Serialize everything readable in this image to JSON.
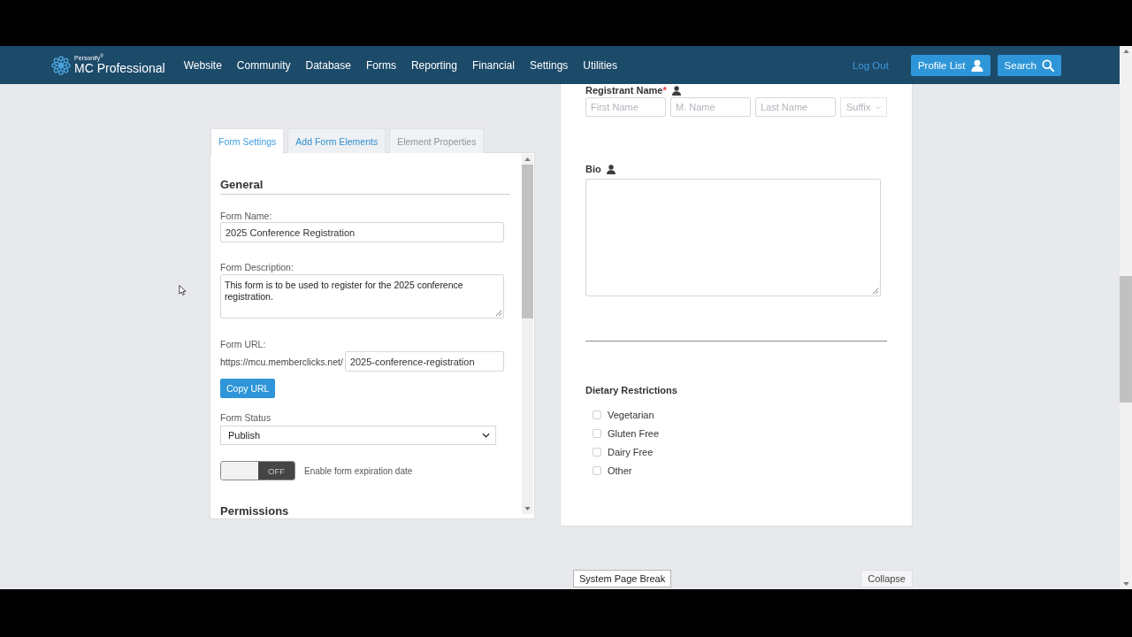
{
  "nav": {
    "logo": {
      "tagline": "Personify$^{®}$",
      "name": "MC Professional"
    },
    "menu": [
      {
        "label": "Website"
      },
      {
        "label": "Community"
      },
      {
        "label": "Database"
      },
      {
        "label": "Forms"
      },
      {
        "label": "Reporting"
      },
      {
        "label": "Financial"
      },
      {
        "label": "Settings"
      },
      {
        "label": "Utilities"
      }
    ],
    "logout": "Log Out",
    "buttons": [
      {
        "kind": "profile_list",
        "label": "Profile List"
      },
      {
        "kind": "search",
        "label": "Search"
      }
    ]
  },
  "form_builder": {
    "tabs": [
      {
        "label": "Form Settings",
        "selected": true,
        "disabled": false
      },
      {
        "label": "Add Form Elements",
        "selected": false,
        "disabled": false
      },
      {
        "label": "Element Properties",
        "selected": false,
        "disabled": true
      }
    ],
    "settings": {
      "general_heading": "General",
      "form_name": {
        "label": "Form Name:",
        "value": "2025 Conference Registration"
      },
      "form_description": {
        "label": "Form Description:",
        "value": "This form is to be used to register for the 2025 conference registration."
      },
      "form_url": {
        "label": "Form URL:",
        "prefix": "https://mcu.memberclicks.net/",
        "value": "2025-conference-registration",
        "copy_button": "Copy URL"
      },
      "form_status": {
        "label": "Form Status",
        "value": "Publish"
      },
      "expiration": {
        "on": false,
        "state_label": "OFF",
        "label": "Enable form expiration date"
      },
      "permissions_heading": "Permissions"
    }
  },
  "preview": {
    "fields": [
      {
        "kind": "name",
        "label": "Registrant Name",
        "required_mark": "*",
        "profile_linked": true,
        "parts": [
          {
            "placeholder": "First Name"
          },
          {
            "placeholder": "M. Name"
          },
          {
            "placeholder": "Last Name"
          }
        ],
        "suffix": {
          "placeholder": "Suffix"
        }
      },
      {
        "kind": "textarea",
        "label": "Bio",
        "profile_linked": true
      },
      {
        "kind": "divider"
      },
      {
        "kind": "checkboxes",
        "label": "Dietary Restrictions",
        "profile_linked": false,
        "options": [
          {
            "label": "Vegetarian",
            "checked": false
          },
          {
            "label": "Gluten Free",
            "checked": false
          },
          {
            "label": "Dairy Free",
            "checked": false
          },
          {
            "label": "Other",
            "checked": false
          }
        ]
      }
    ],
    "page_break": "System Page Break",
    "collapse": "Collapse"
  }
}
